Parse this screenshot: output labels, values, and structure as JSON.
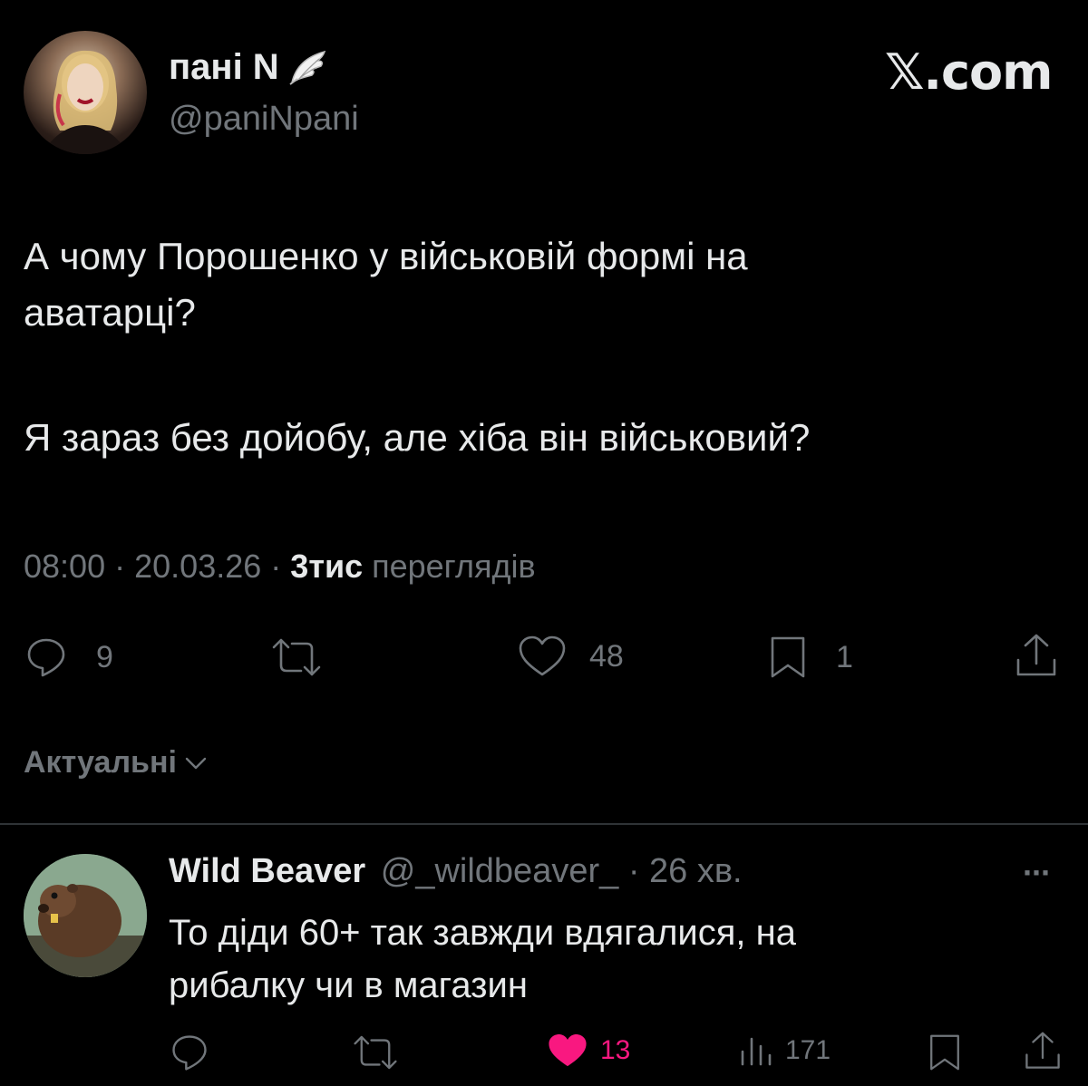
{
  "post": {
    "author_name": "пані N",
    "author_handle": "@paniNpani",
    "site_label": "𝕏.com",
    "text_line1": "А чому Порошенко у військовій формі на",
    "text_line2": "аватарці?",
    "text_line3": "Я зараз без дойобу, але хіба він військовий?",
    "time": "08:00",
    "date": "20.03.26",
    "sep": "·",
    "views_value": "3тис",
    "views_label": "переглядів",
    "replies": "9",
    "reposts": "",
    "likes": "48",
    "bookmarks": "1"
  },
  "filter": {
    "label": "Актуальні"
  },
  "reply": {
    "author_name": "Wild Beaver",
    "author_handle": "@_wildbeaver_",
    "age": "· 26 хв.",
    "more": "···",
    "text_line1": "То діди 60+ так завжди вдягалися, на",
    "text_line2": "рибалку чи в магазин",
    "likes": "13",
    "views": "171"
  },
  "colors": {
    "background": "#000000",
    "text": "#e7e9ea",
    "muted": "#71767b",
    "like_active": "#f91880",
    "divider": "#2f3336"
  },
  "icons": [
    "reply-icon",
    "repost-icon",
    "like-icon",
    "bookmark-icon",
    "share-icon",
    "views-icon",
    "verified-wing-icon",
    "chevron-down-icon",
    "more-icon"
  ]
}
